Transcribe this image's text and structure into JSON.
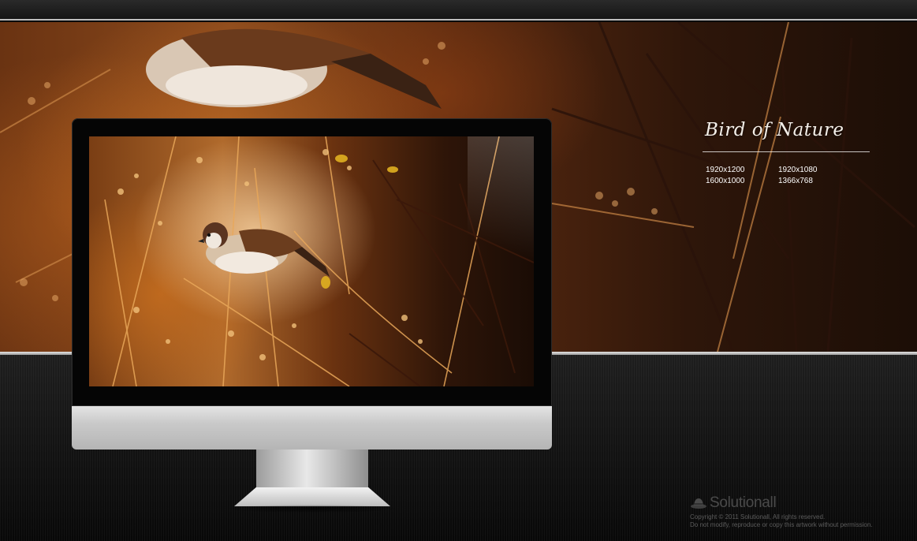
{
  "artwork": {
    "title": "Bird of Nature",
    "resolutions": [
      "1920x1200",
      "1920x1080",
      "1600x1000",
      "1366x768"
    ]
  },
  "brand": {
    "name": "Solutionall",
    "copyright_line": "Copyright © 2011 Solutionall, All rights reserved.",
    "notice_line": "Do not modify, reproduce or copy this artwork without permission."
  },
  "colors": {
    "background": "#0b0b0b",
    "photo_warm": "#b06a2c",
    "photo_dark": "#1a0c05",
    "bezel": "#050505",
    "chin_silver": "#c9c9c9"
  }
}
